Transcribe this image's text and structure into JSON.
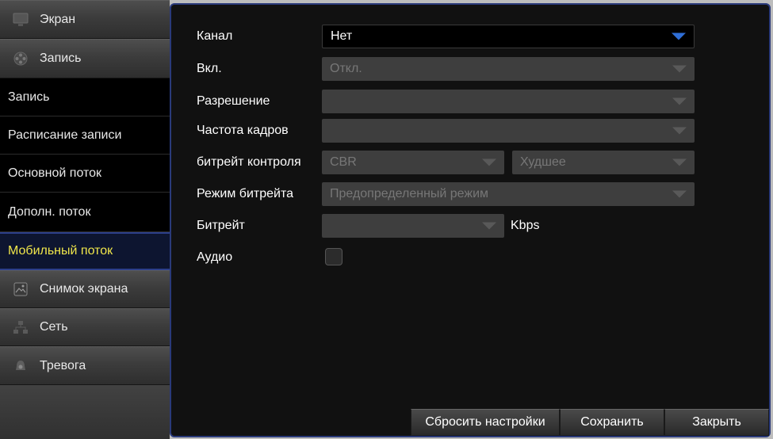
{
  "sidebar": {
    "categories": [
      {
        "label": "Экран",
        "icon": "monitor-icon"
      },
      {
        "label": "Запись",
        "icon": "film-reel-icon"
      },
      {
        "label": "Снимок экрана",
        "icon": "snapshot-icon"
      },
      {
        "label": "Сеть",
        "icon": "network-icon"
      },
      {
        "label": "Тревога",
        "icon": "alarm-icon"
      }
    ],
    "record_subitems": [
      "Запись",
      "Расписание записи",
      "Основной поток",
      "Дополн. поток",
      "Мобильный поток"
    ],
    "active_subitem": "Мобильный поток"
  },
  "form": {
    "channel": {
      "label": "Канал",
      "value": "Нет"
    },
    "enable": {
      "label": "Вкл.",
      "value": "Откл."
    },
    "resolution": {
      "label": "Разрешение",
      "value": ""
    },
    "framerate": {
      "label": "Частота кадров",
      "value": ""
    },
    "bitrate_control": {
      "label": "битрейт контроля",
      "mode": "CBR",
      "quality": "Худшее"
    },
    "bitrate_mode": {
      "label": "Режим битрейта",
      "value": "Предопределенный режим"
    },
    "bitrate": {
      "label": "Битрейт",
      "value": "",
      "unit": "Kbps"
    },
    "audio": {
      "label": "Аудио",
      "checked": false
    }
  },
  "buttons": {
    "reset": "Сбросить настройки",
    "save": "Сохранить",
    "close": "Закрыть"
  },
  "colors": {
    "active_text": "#f0e64a",
    "accent_border": "#2a3a7a",
    "dropdown_arrow_enabled": "#2f6ed6"
  }
}
